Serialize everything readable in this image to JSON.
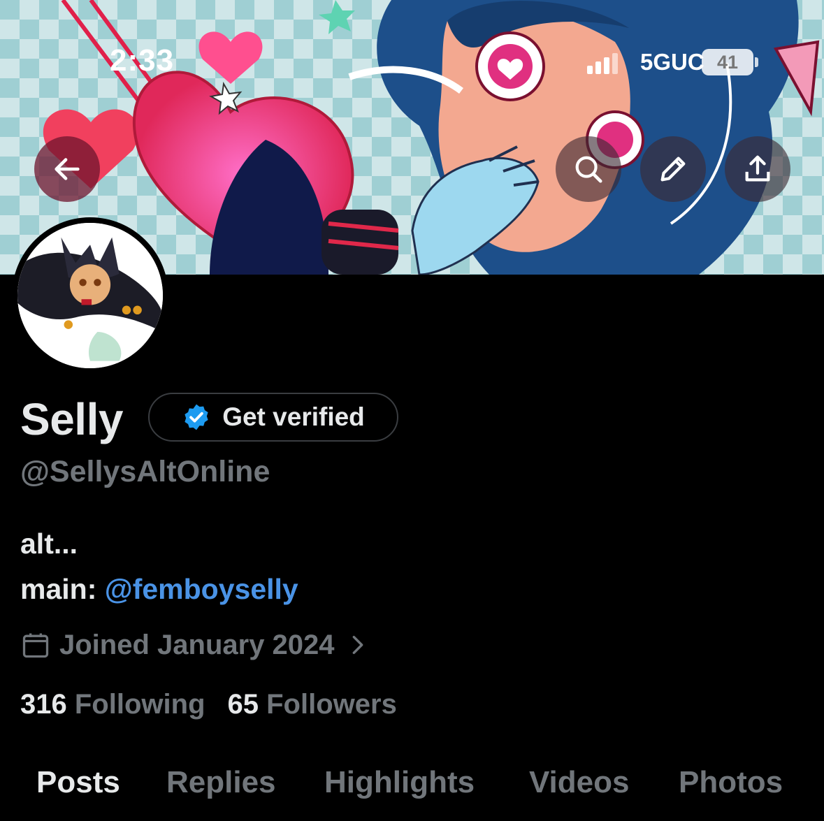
{
  "status_bar": {
    "time": "2:33",
    "network": "5GUC",
    "battery": "41"
  },
  "header": {
    "back_icon": "arrow-left-icon",
    "search_icon": "search-icon",
    "edit_icon": "pencil-icon",
    "share_icon": "share-upload-icon"
  },
  "profile": {
    "display_name": "Selly",
    "get_verified_label": "Get verified",
    "handle": "@SellysAltOnline",
    "bio_line1": "alt...",
    "bio_line2_prefix": "main: ",
    "bio_line2_link": "@femboyselly",
    "joined": "Joined January 2024",
    "following_count": "316",
    "following_label": "Following",
    "followers_count": "65",
    "followers_label": "Followers"
  },
  "tabs": [
    {
      "label": "Posts",
      "active": true
    },
    {
      "label": "Replies",
      "active": false
    },
    {
      "label": "Highlights",
      "active": false
    },
    {
      "label": "Videos",
      "active": false
    },
    {
      "label": "Photos",
      "active": false
    }
  ],
  "colors": {
    "background": "#000000",
    "primary_text": "#e7e9ea",
    "secondary_text": "#71767b",
    "link": "#4a93e6",
    "verified_badge": "#1d9bf0"
  }
}
